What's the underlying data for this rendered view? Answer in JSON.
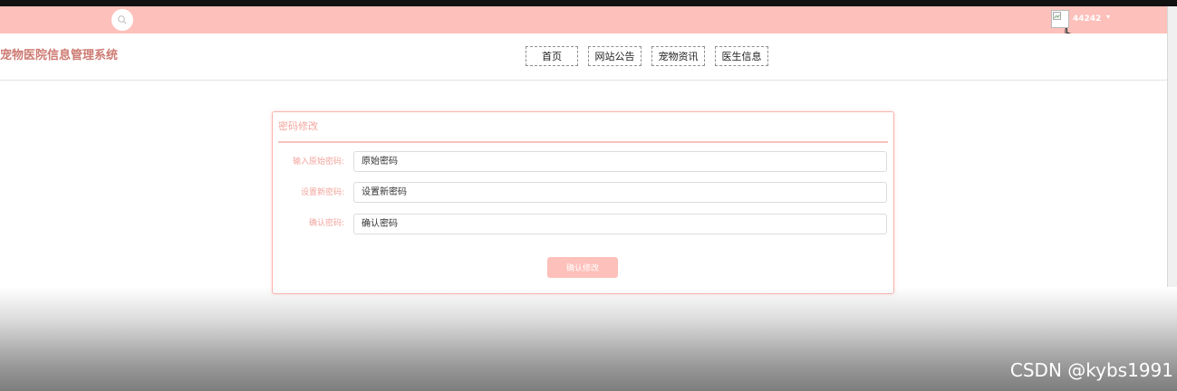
{
  "topbar": {
    "username": "44242",
    "caret": "▾",
    "search_icon": "search-icon",
    "avatar_icon": "broken-image-avatar",
    "cursor_icon": "hand-pointer-icon",
    "bar_color": "#fdc0ba"
  },
  "header": {
    "site_title": "宠物医院信息管理系统",
    "nav": [
      "首页",
      "网站公告",
      "宠物资讯",
      "医生信息"
    ]
  },
  "form": {
    "title": "密码修改",
    "fields": [
      {
        "label": "输入原始密码:",
        "placeholder": "原始密码"
      },
      {
        "label": "设置新密码:",
        "placeholder": "设置新密码"
      },
      {
        "label": "确认密码:",
        "placeholder": "确认密码"
      }
    ],
    "submit_label": "确认修改",
    "accent_color": "#f9b4ad"
  },
  "watermark": "CSDN @kybs1991"
}
